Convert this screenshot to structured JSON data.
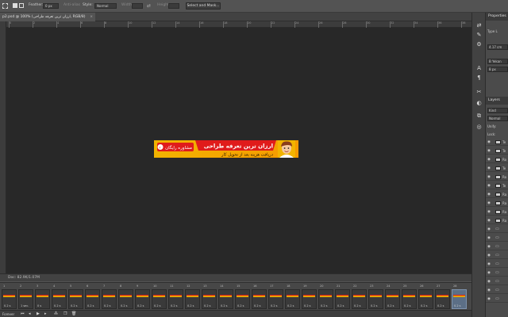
{
  "options_bar": {
    "feather_label": "Feather:",
    "feather_value": "0 px",
    "antialias_label": "Anti-alias",
    "style_label": "Style:",
    "style_value": "Normal",
    "width_label": "Width:",
    "height_label": "Height:",
    "select_mask_label": "Select and Mask..."
  },
  "document_tab": {
    "title": "p2.psd @ 100% (ارزان ترین تعرفه طراحی, RGB/8)",
    "close": "×"
  },
  "ruler_ticks": [
    "0",
    "2",
    "4",
    "6",
    "8",
    "10",
    "12",
    "14",
    "16",
    "18",
    "20",
    "22",
    "24",
    "26",
    "28",
    "30",
    "32",
    "34",
    "36",
    "38"
  ],
  "banner": {
    "headline": "ارزان ترین تعرفه طراحی",
    "subline": "دریافت هزینه بعد از تحویل کار",
    "cta": "مشاوره رایگان",
    "colors": {
      "accent": "#e01b1b",
      "background": "#f2b300",
      "gradient_end": "#f59a00"
    }
  },
  "status_bar": {
    "text": "Doc: 82.9K/1.07M"
  },
  "timeline": {
    "frames": [
      {
        "n": "1",
        "d": "0.2 s"
      },
      {
        "n": "2",
        "d": "1 sec."
      },
      {
        "n": "3",
        "d": "0 s"
      },
      {
        "n": "4",
        "d": "0.2 s"
      },
      {
        "n": "5",
        "d": "0.2 s"
      },
      {
        "n": "6",
        "d": "0.2 s"
      },
      {
        "n": "7",
        "d": "0.2 s"
      },
      {
        "n": "8",
        "d": "0.2 s"
      },
      {
        "n": "9",
        "d": "0.2 s"
      },
      {
        "n": "10",
        "d": "0.2 s"
      },
      {
        "n": "11",
        "d": "0.2 s"
      },
      {
        "n": "12",
        "d": "0.2 s"
      },
      {
        "n": "13",
        "d": "0.2 s"
      },
      {
        "n": "14",
        "d": "0.2 s"
      },
      {
        "n": "15",
        "d": "0.2 s"
      },
      {
        "n": "16",
        "d": "0.2 s"
      },
      {
        "n": "17",
        "d": "0.2 s"
      },
      {
        "n": "18",
        "d": "0.2 s"
      },
      {
        "n": "19",
        "d": "0.2 s"
      },
      {
        "n": "20",
        "d": "0.2 s"
      },
      {
        "n": "21",
        "d": "0.2 s"
      },
      {
        "n": "22",
        "d": "0.2 s"
      },
      {
        "n": "23",
        "d": "0.2 s"
      },
      {
        "n": "24",
        "d": "0.2 s"
      },
      {
        "n": "25",
        "d": "0.2 s"
      },
      {
        "n": "26",
        "d": "0.2 s"
      },
      {
        "n": "27",
        "d": "0.2 s"
      },
      {
        "n": "28",
        "d": "0.2 s"
      }
    ],
    "loop_label": "Forever"
  },
  "properties_panel": {
    "title": "Properties",
    "type_label": "Type L",
    "size_value": "4.17 cm",
    "font_value": "B Yekan",
    "size_pt": "8 px",
    "tracking": "0"
  },
  "layers_panel": {
    "title": "Layers",
    "kind_label": "Kind",
    "blend_value": "Normal",
    "opacity_label": "Unify:",
    "lock_label": "Lock:",
    "layer_names": [
      "Te",
      "Te",
      "Ro",
      "Te",
      "Ro",
      "Te",
      "Ra",
      "Ra",
      "Ra",
      "Ra",
      "",
      "",
      "",
      "",
      "",
      "",
      "",
      "",
      ""
    ]
  }
}
